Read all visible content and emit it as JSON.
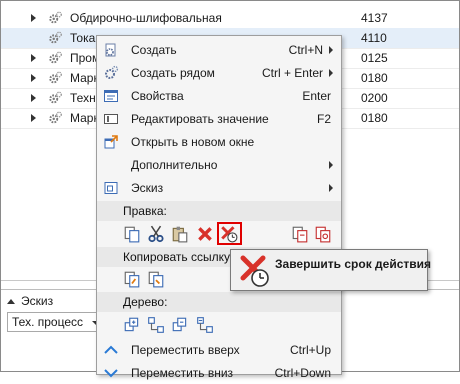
{
  "tree": {
    "rows": [
      {
        "name": "Обдирочно-шлифовальная",
        "code": "4137",
        "selected": false
      },
      {
        "name": "Токарная",
        "code": "4110",
        "selected": true
      },
      {
        "name": "Пром",
        "code": "0125",
        "selected": false
      },
      {
        "name": "Марк",
        "code": "0180",
        "selected": false
      },
      {
        "name": "Техн",
        "code": "0200",
        "selected": false
      },
      {
        "name": "Марк",
        "code": "0180",
        "selected": false
      }
    ]
  },
  "sketch_panel": {
    "title": "Эскиз",
    "select_value": "Тех. процесс"
  },
  "context_menu": {
    "items": [
      {
        "label": "Создать",
        "shortcut": "Ctrl+N",
        "submenu": true,
        "icon": "create-icon"
      },
      {
        "label": "Создать рядом",
        "shortcut": "Ctrl + Enter",
        "submenu": true,
        "icon": "create-near-icon"
      },
      {
        "label": "Свойства",
        "shortcut": "Enter",
        "submenu": false,
        "icon": "properties-icon"
      },
      {
        "label": "Редактировать значение",
        "shortcut": "F2",
        "submenu": false,
        "icon": "edit-value-icon"
      },
      {
        "label": "Открыть в новом окне",
        "shortcut": "",
        "submenu": false,
        "icon": "open-new-window-icon"
      },
      {
        "label": "Дополнительно",
        "shortcut": "",
        "submenu": true,
        "icon": ""
      },
      {
        "label": "Эскиз",
        "shortcut": "",
        "submenu": true,
        "icon": "sketch-icon"
      }
    ],
    "section_edit": "Правка:",
    "section_copy_link": "Копировать ссылку",
    "section_tree": "Дерево:",
    "move_up": {
      "label": "Переместить вверх",
      "shortcut": "Ctrl+Up"
    },
    "move_down": {
      "label": "Переместить вниз",
      "shortcut": "Ctrl+Down"
    }
  },
  "tooltip": {
    "label": "Завершить срок действия"
  },
  "colors": {
    "accent": "#2a7ad5",
    "highlight": "#e00000",
    "selected_row": "#e4eef9",
    "delete_red": "#d8322a"
  }
}
